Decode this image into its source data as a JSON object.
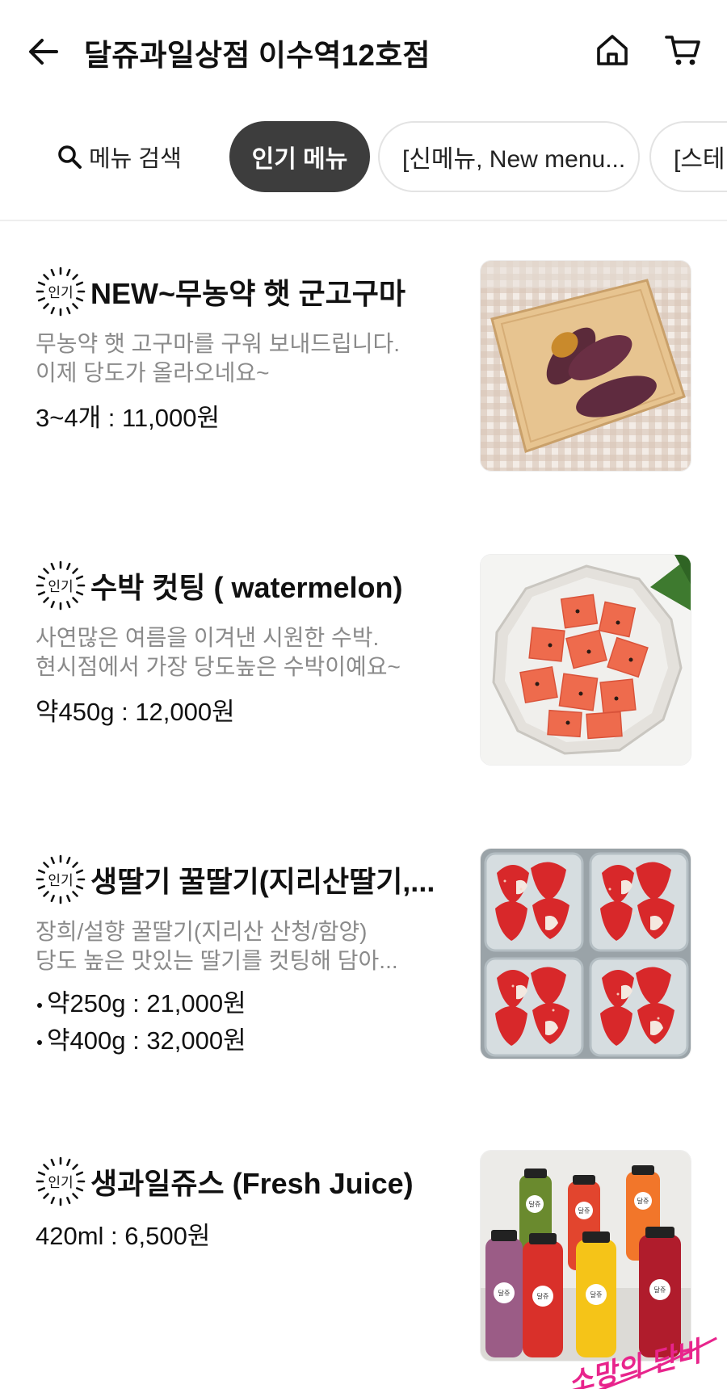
{
  "header": {
    "title": "달쥬과일상점 이수역12호점",
    "back_icon": "arrow-left-icon",
    "home_icon": "home-icon",
    "cart_icon": "cart-icon"
  },
  "tabs": {
    "search_label": "메뉴 검색",
    "chips": [
      {
        "label": "인기 메뉴",
        "active": true
      },
      {
        "label": "[신메뉴, New menu..."
      },
      {
        "label": "[스테비"
      }
    ]
  },
  "menu": {
    "badge_label": "인기",
    "items": [
      {
        "title": "NEW~무농약 햇 군고구마",
        "desc": [
          "무농약 햇 고구마를 구워 보내드립니다.",
          "이제 당도가  올라오네요~"
        ],
        "prices": [
          "3~4개 : 11,000원"
        ],
        "image": "roasted-sweet-potato"
      },
      {
        "title": "수박 컷팅 ( watermelon)",
        "desc": [
          "사연많은 여름을 이겨낸 시원한 수박.",
          "현시점에서 가장 당도높은 수박이예요~"
        ],
        "prices": [
          "약450g : 12,000원"
        ],
        "image": "cut-watermelon"
      },
      {
        "title": "생딸기  꿀딸기(지리산딸기,...",
        "desc": [
          "장희/설향 꿀딸기(지리산 산청/함양)",
          "당도 높은 맛있는 딸기를 컷팅해 담아..."
        ],
        "prices": [
          "약250g : 21,000원",
          "약400g : 32,000원"
        ],
        "image": "cut-strawberries"
      },
      {
        "title": "생과일쥬스 (Fresh Juice)",
        "desc": [],
        "prices": [
          "420ml : 6,500원"
        ],
        "image": "fresh-juice-bottles"
      }
    ]
  },
  "bottle_label": "달쥬",
  "watermark": "소망의 단비",
  "colors": {
    "active_chip": "#3d3d3d",
    "desc_gray": "#8a8a8a",
    "watermark_pink": "#e8248c"
  }
}
